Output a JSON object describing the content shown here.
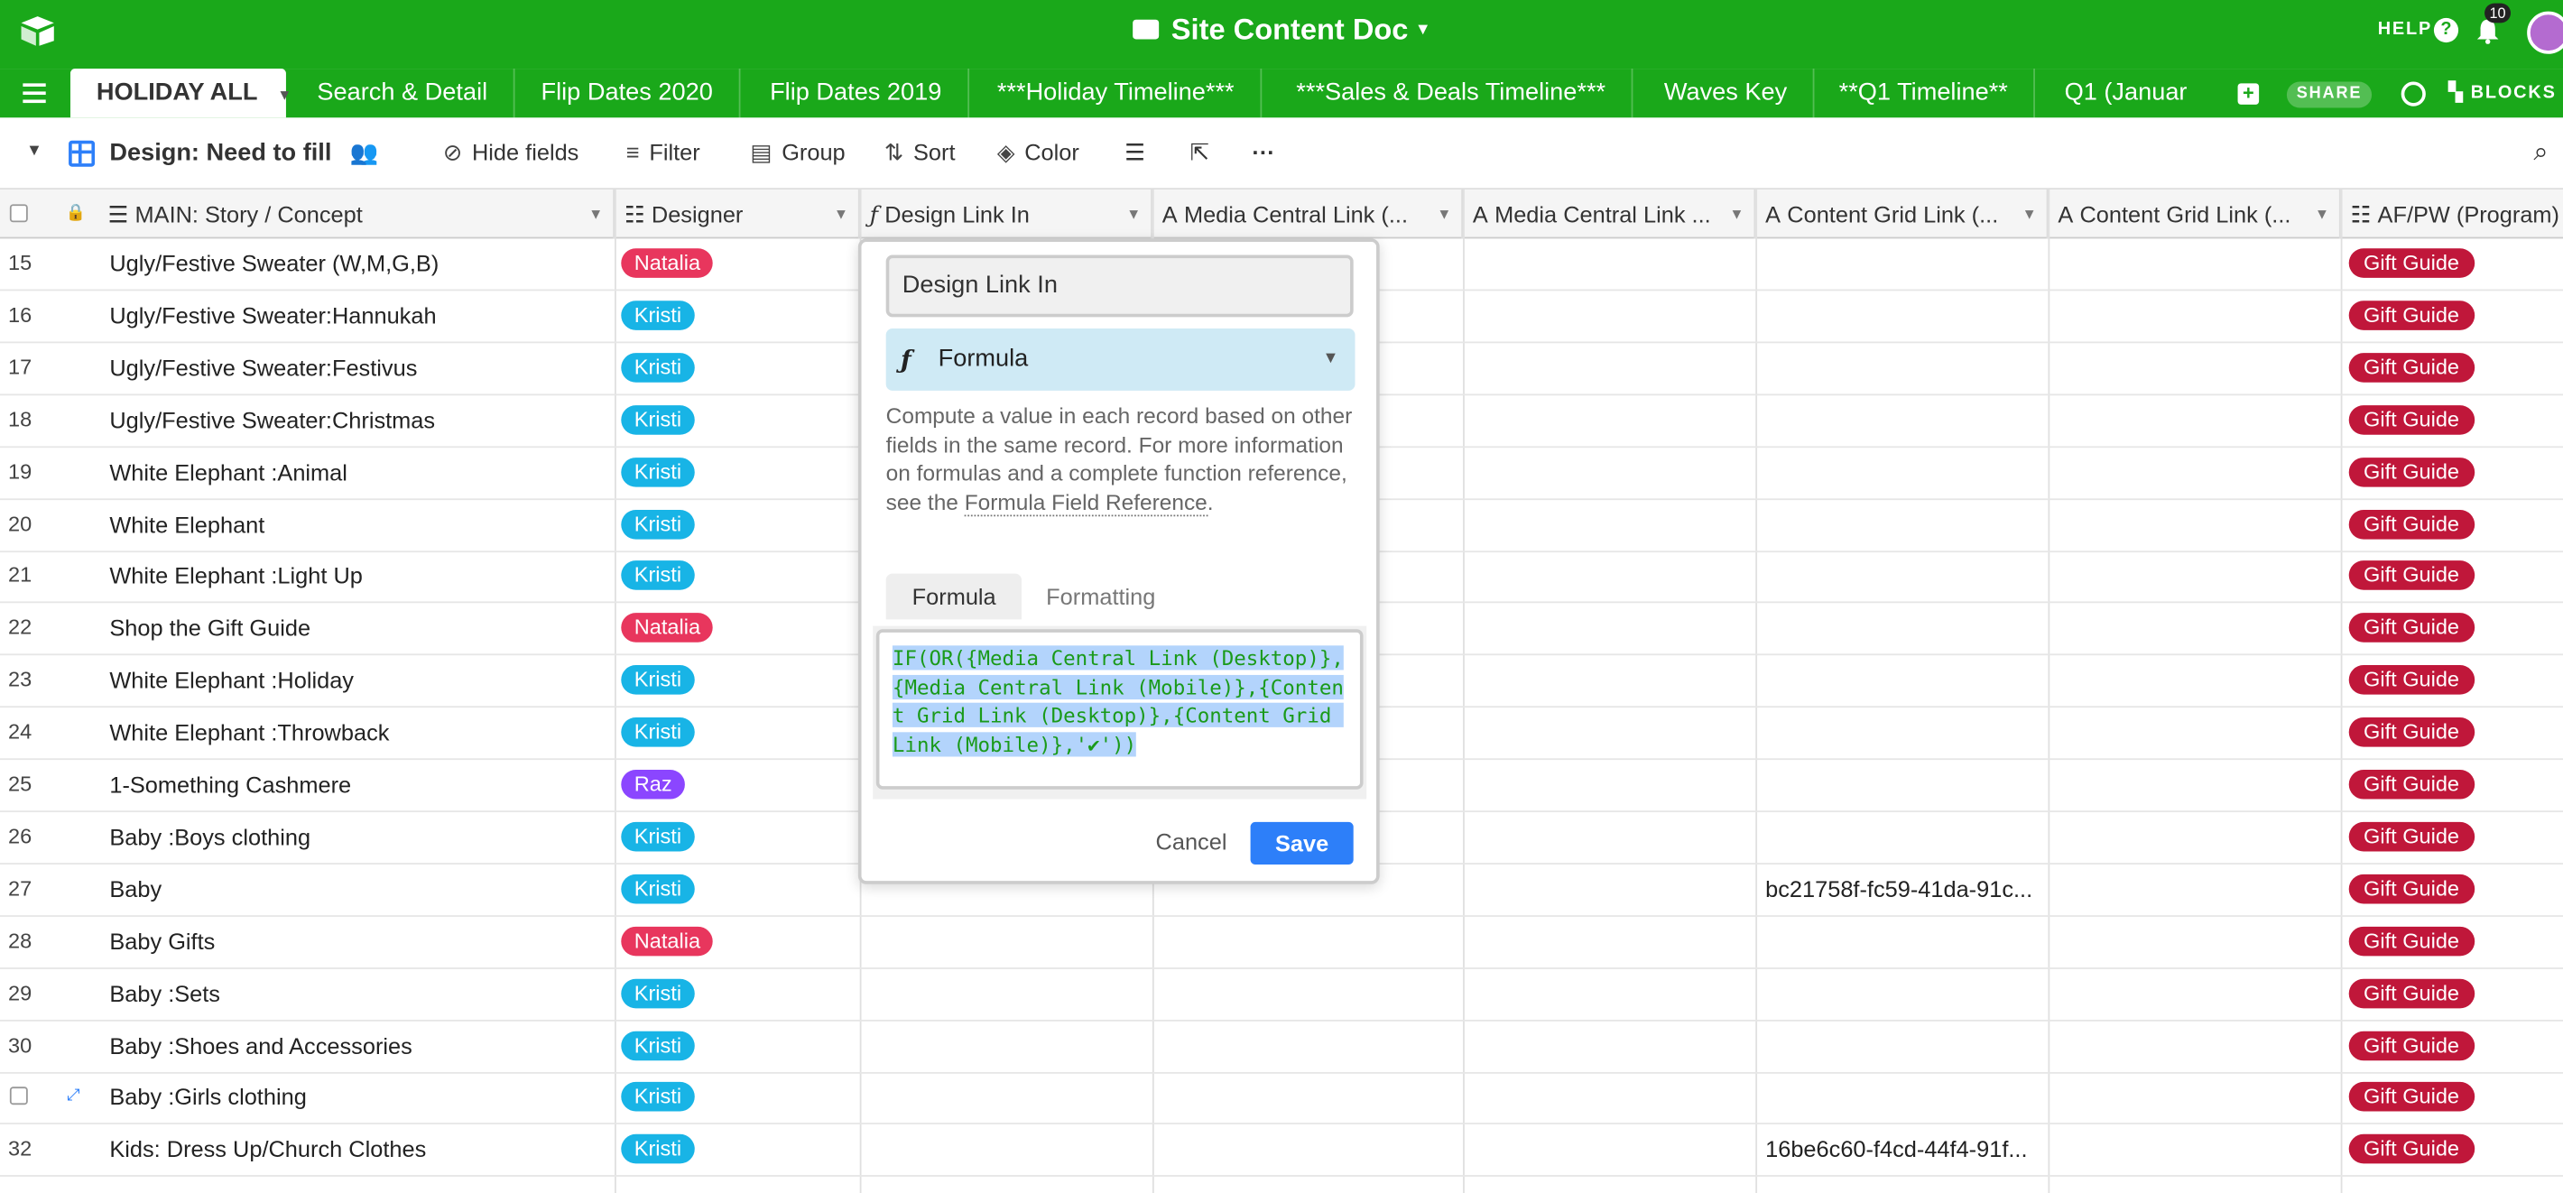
{
  "app": {
    "base_title": "Site Content Doc",
    "help_label": "HELP",
    "notification_count": "10",
    "brand_color": "#1aa81a"
  },
  "tabs": [
    {
      "label": "HOLIDAY ALL",
      "active": true
    },
    {
      "label": "Search & Detail"
    },
    {
      "label": "Flip Dates 2020"
    },
    {
      "label": "Flip Dates 2019"
    },
    {
      "label": "***Holiday Timeline***"
    },
    {
      "label": "***Sales & Deals Timeline***"
    },
    {
      "label": "Waves Key"
    },
    {
      "label": "**Q1 Timeline**"
    },
    {
      "label": "Q1 (Januar"
    }
  ],
  "tabbar_right": {
    "share_label": "SHARE",
    "blocks_label": "BLOCKS"
  },
  "viewbar": {
    "view_name": "Design: Need to fill",
    "hide_fields": "Hide fields",
    "filter": "Filter",
    "group": "Group",
    "sort": "Sort",
    "color": "Color"
  },
  "columns": [
    {
      "label": "MAIN: Story / Concept",
      "icon": "long-text-icon"
    },
    {
      "label": "Designer",
      "icon": "multi-select-icon"
    },
    {
      "label": "Design Link In",
      "icon": "formula-icon"
    },
    {
      "label": "Media Central Link (...",
      "icon": "text-icon"
    },
    {
      "label": "Media Central Link ...",
      "icon": "text-icon"
    },
    {
      "label": "Content Grid Link (...",
      "icon": "text-icon"
    },
    {
      "label": "Content Grid Link (...",
      "icon": "text-icon"
    },
    {
      "label": "AF/PW (Program)",
      "icon": "multi-select-icon"
    }
  ],
  "rows": [
    {
      "num": "15",
      "name": "Ugly/Festive Sweater (W,M,G,B)",
      "designer": "Natalia",
      "content_grid": "",
      "program": "Gift Guide"
    },
    {
      "num": "16",
      "name": "Ugly/Festive Sweater:Hannukah",
      "designer": "Kristi",
      "content_grid": "",
      "program": "Gift Guide"
    },
    {
      "num": "17",
      "name": "Ugly/Festive Sweater:Festivus",
      "designer": "Kristi",
      "content_grid": "",
      "program": "Gift Guide"
    },
    {
      "num": "18",
      "name": "Ugly/Festive Sweater:Christmas",
      "designer": "Kristi",
      "content_grid": "",
      "program": "Gift Guide"
    },
    {
      "num": "19",
      "name": "White Elephant :Animal",
      "designer": "Kristi",
      "content_grid": "",
      "program": "Gift Guide"
    },
    {
      "num": "20",
      "name": "White Elephant",
      "designer": "Kristi",
      "content_grid": "",
      "program": "Gift Guide"
    },
    {
      "num": "21",
      "name": "White Elephant :Light Up",
      "designer": "Kristi",
      "content_grid": "",
      "program": "Gift Guide"
    },
    {
      "num": "22",
      "name": "Shop the Gift Guide",
      "designer": "Natalia",
      "content_grid": "",
      "program": "Gift Guide"
    },
    {
      "num": "23",
      "name": "White Elephant :Holiday",
      "designer": "Kristi",
      "content_grid": "",
      "program": "Gift Guide"
    },
    {
      "num": "24",
      "name": "White Elephant :Throwback",
      "designer": "Kristi",
      "content_grid": "",
      "program": "Gift Guide"
    },
    {
      "num": "25",
      "name": "1-Something Cashmere",
      "designer": "Raz",
      "content_grid": "",
      "program": "Gift Guide"
    },
    {
      "num": "26",
      "name": "Baby :Boys clothing",
      "designer": "Kristi",
      "content_grid": "",
      "program": "Gift Guide"
    },
    {
      "num": "27",
      "name": "Baby",
      "designer": "Kristi",
      "content_grid": "bc21758f-fc59-41da-91c...",
      "program": "Gift Guide"
    },
    {
      "num": "28",
      "name": "Baby Gifts",
      "designer": "Natalia",
      "content_grid": "",
      "program": "Gift Guide"
    },
    {
      "num": "29",
      "name": "Baby :Sets",
      "designer": "Kristi",
      "content_grid": "",
      "program": "Gift Guide"
    },
    {
      "num": "30",
      "name": "Baby :Shoes and Accessories",
      "designer": "Kristi",
      "content_grid": "",
      "program": "Gift Guide"
    },
    {
      "num": "",
      "name": "Baby :Girls clothing",
      "designer": "Kristi",
      "content_grid": "",
      "program": "Gift Guide"
    },
    {
      "num": "32",
      "name": "Kids: Dress Up/Church Clothes",
      "designer": "Kristi",
      "content_grid": "16be6c60-f4cd-44f4-91f...",
      "program": "Gift Guide"
    }
  ],
  "designer_colors": {
    "Natalia": "#e8365d",
    "Kristi": "#18b4e6",
    "Raz": "#8b46ff"
  },
  "popup": {
    "field_name": "Design Link In",
    "field_type": "Formula",
    "description": "Compute a value in each record based on other fields in the same record. For more information on formulas and a complete function reference, see the ",
    "description_link": "Formula Field Reference",
    "description_end": ".",
    "tab_formula": "Formula",
    "tab_formatting": "Formatting",
    "formula": "IF(OR({Media Central Link (Desktop)},{Media Central Link (Mobile)},{Content Grid Link (Desktop)},{Content Grid Link (Mobile)},'✔'))",
    "cancel": "Cancel",
    "save": "Save"
  }
}
